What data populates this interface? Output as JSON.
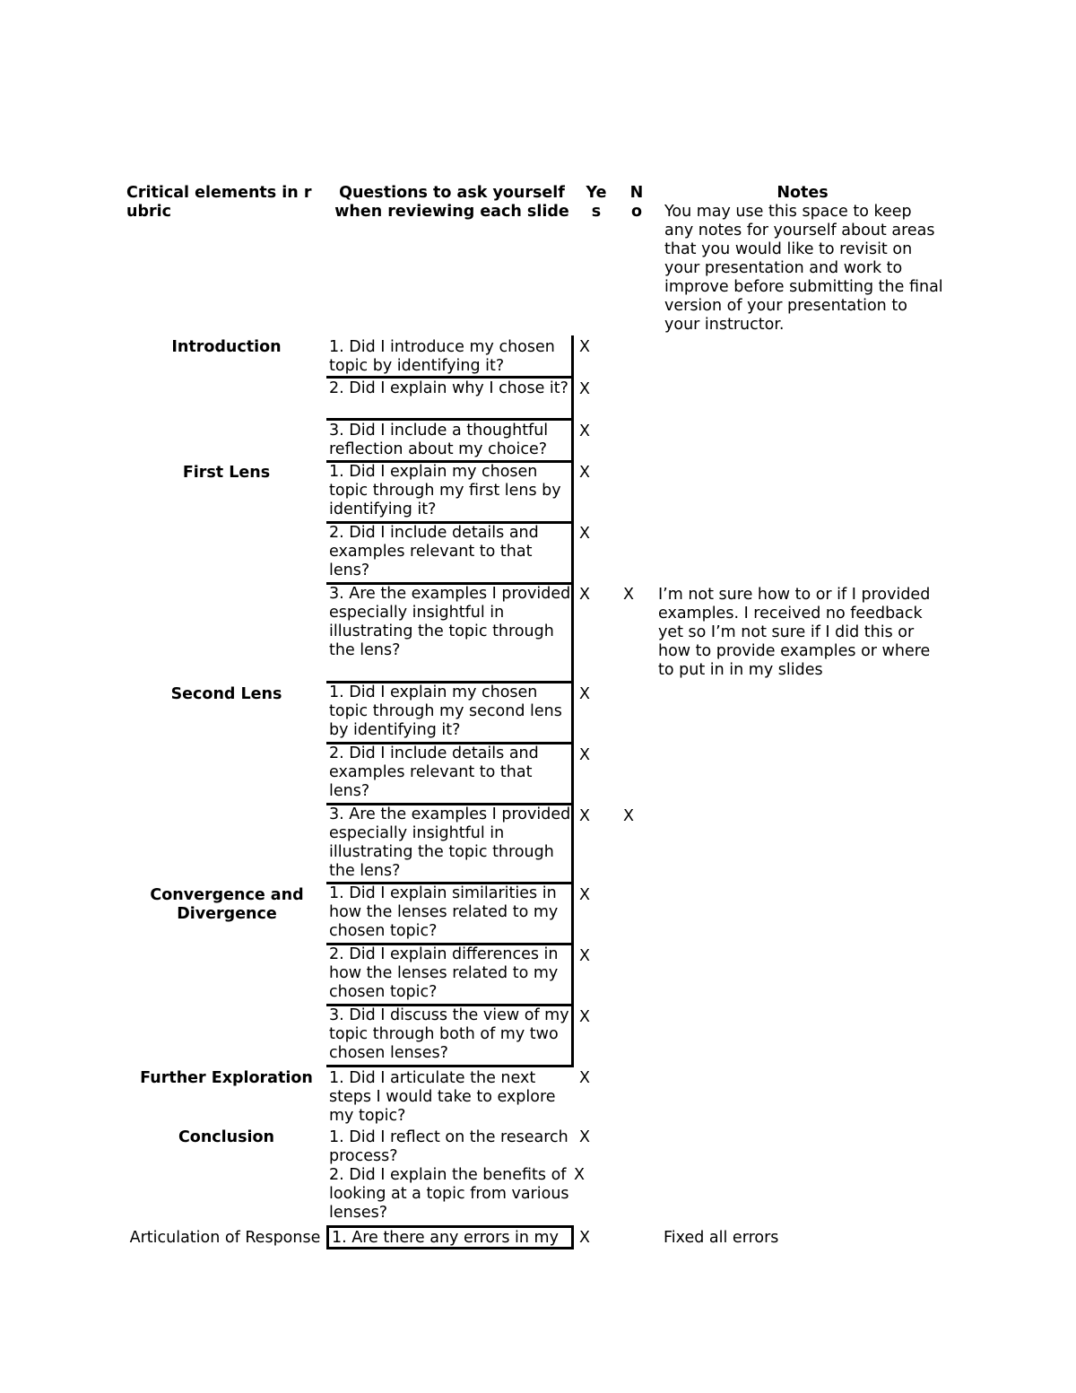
{
  "header": {
    "critical": "Critical elements in r ubric",
    "critical_line1": "Critical elements in r",
    "critical_line2": "ubric",
    "questions": "Questions to ask yourself when reviewing each slide",
    "yes_line1": "Ye",
    "yes_line2": "s",
    "no_line1": "N",
    "no_line2": "o",
    "notes": "Notes",
    "notes_description": "You may use this space to keep any notes for yourself about areas that you would like to revisit on your presentation and work to improve before submitting the final version of your presentation to your instructor."
  },
  "sections": [
    {
      "label": "Introduction",
      "rows": [
        {
          "question": "1. Did I introduce my chosen topic by identifying it?",
          "yes": "X",
          "no": "",
          "note": ""
        },
        {
          "question": "2. Did I explain why I chose it?",
          "yes": "X",
          "no": "",
          "note": ""
        },
        {
          "question": "3. Did I include a thoughtful reflection about my choice?",
          "yes": "X",
          "no": "",
          "note": ""
        }
      ]
    },
    {
      "label": "First Lens",
      "rows": [
        {
          "question": "1. Did I explain my chosen topic through my first lens by identifying it?",
          "yes": "X",
          "no": "",
          "note": ""
        },
        {
          "question": "2. Did I include details and examples relevant to that lens?",
          "yes": "X",
          "no": "",
          "note": ""
        },
        {
          "question": "3. Are the examples I provided especially insightful in illustrating the topic through the lens?",
          "yes": "X",
          "no": "X",
          "note": "I’m not sure how to or if I provided examples.  I received no feedback yet so I’m not sure if I did this or how to provide examples or where to put in in my slides"
        }
      ]
    },
    {
      "label": "Second Lens",
      "rows": [
        {
          "question": "1. Did I explain my chosen topic through my second lens by identifying it?",
          "yes": "X",
          "no": "",
          "note": ""
        },
        {
          "question": "2. Did I include details and examples relevant to that lens?",
          "yes": "X",
          "no": "",
          "note": ""
        },
        {
          "question": "3. Are the examples I provided especially insightful in illustrating the topic through the lens?",
          "yes": "X",
          "no": "X",
          "note": ""
        }
      ]
    },
    {
      "label": "Convergence and Divergence",
      "rows": [
        {
          "question": "1. Did I explain similarities in how the lenses related to my chosen topic?",
          "yes": "X",
          "no": "",
          "note": ""
        },
        {
          "question": "2. Did I explain differences in how the lenses related to my chosen topic?",
          "yes": "X",
          "no": "",
          "note": ""
        },
        {
          "question": "3. Did I discuss the view of my topic through both of my two chosen lenses?",
          "yes": "X",
          "no": "",
          "note": ""
        }
      ]
    },
    {
      "label": "Further Exploration",
      "rows": [
        {
          "question": "1. Did I articulate the next steps I would take to explore my topic?",
          "yes": "X",
          "no": "",
          "note": ""
        }
      ]
    },
    {
      "label": "Conclusion",
      "rows": [
        {
          "question": "1. Did I reflect on the research process?",
          "yes": "X",
          "no": "",
          "note": ""
        },
        {
          "question": "2. Did I explain the benefits of looking at a topic from various lenses?",
          "yes": "X",
          "no": "",
          "note": ""
        }
      ]
    },
    {
      "label": "Articulation of Response",
      "rows": [
        {
          "question": "1. Are there any errors in my",
          "yes": "X",
          "no": "",
          "note": "Fixed all errors"
        }
      ]
    }
  ]
}
